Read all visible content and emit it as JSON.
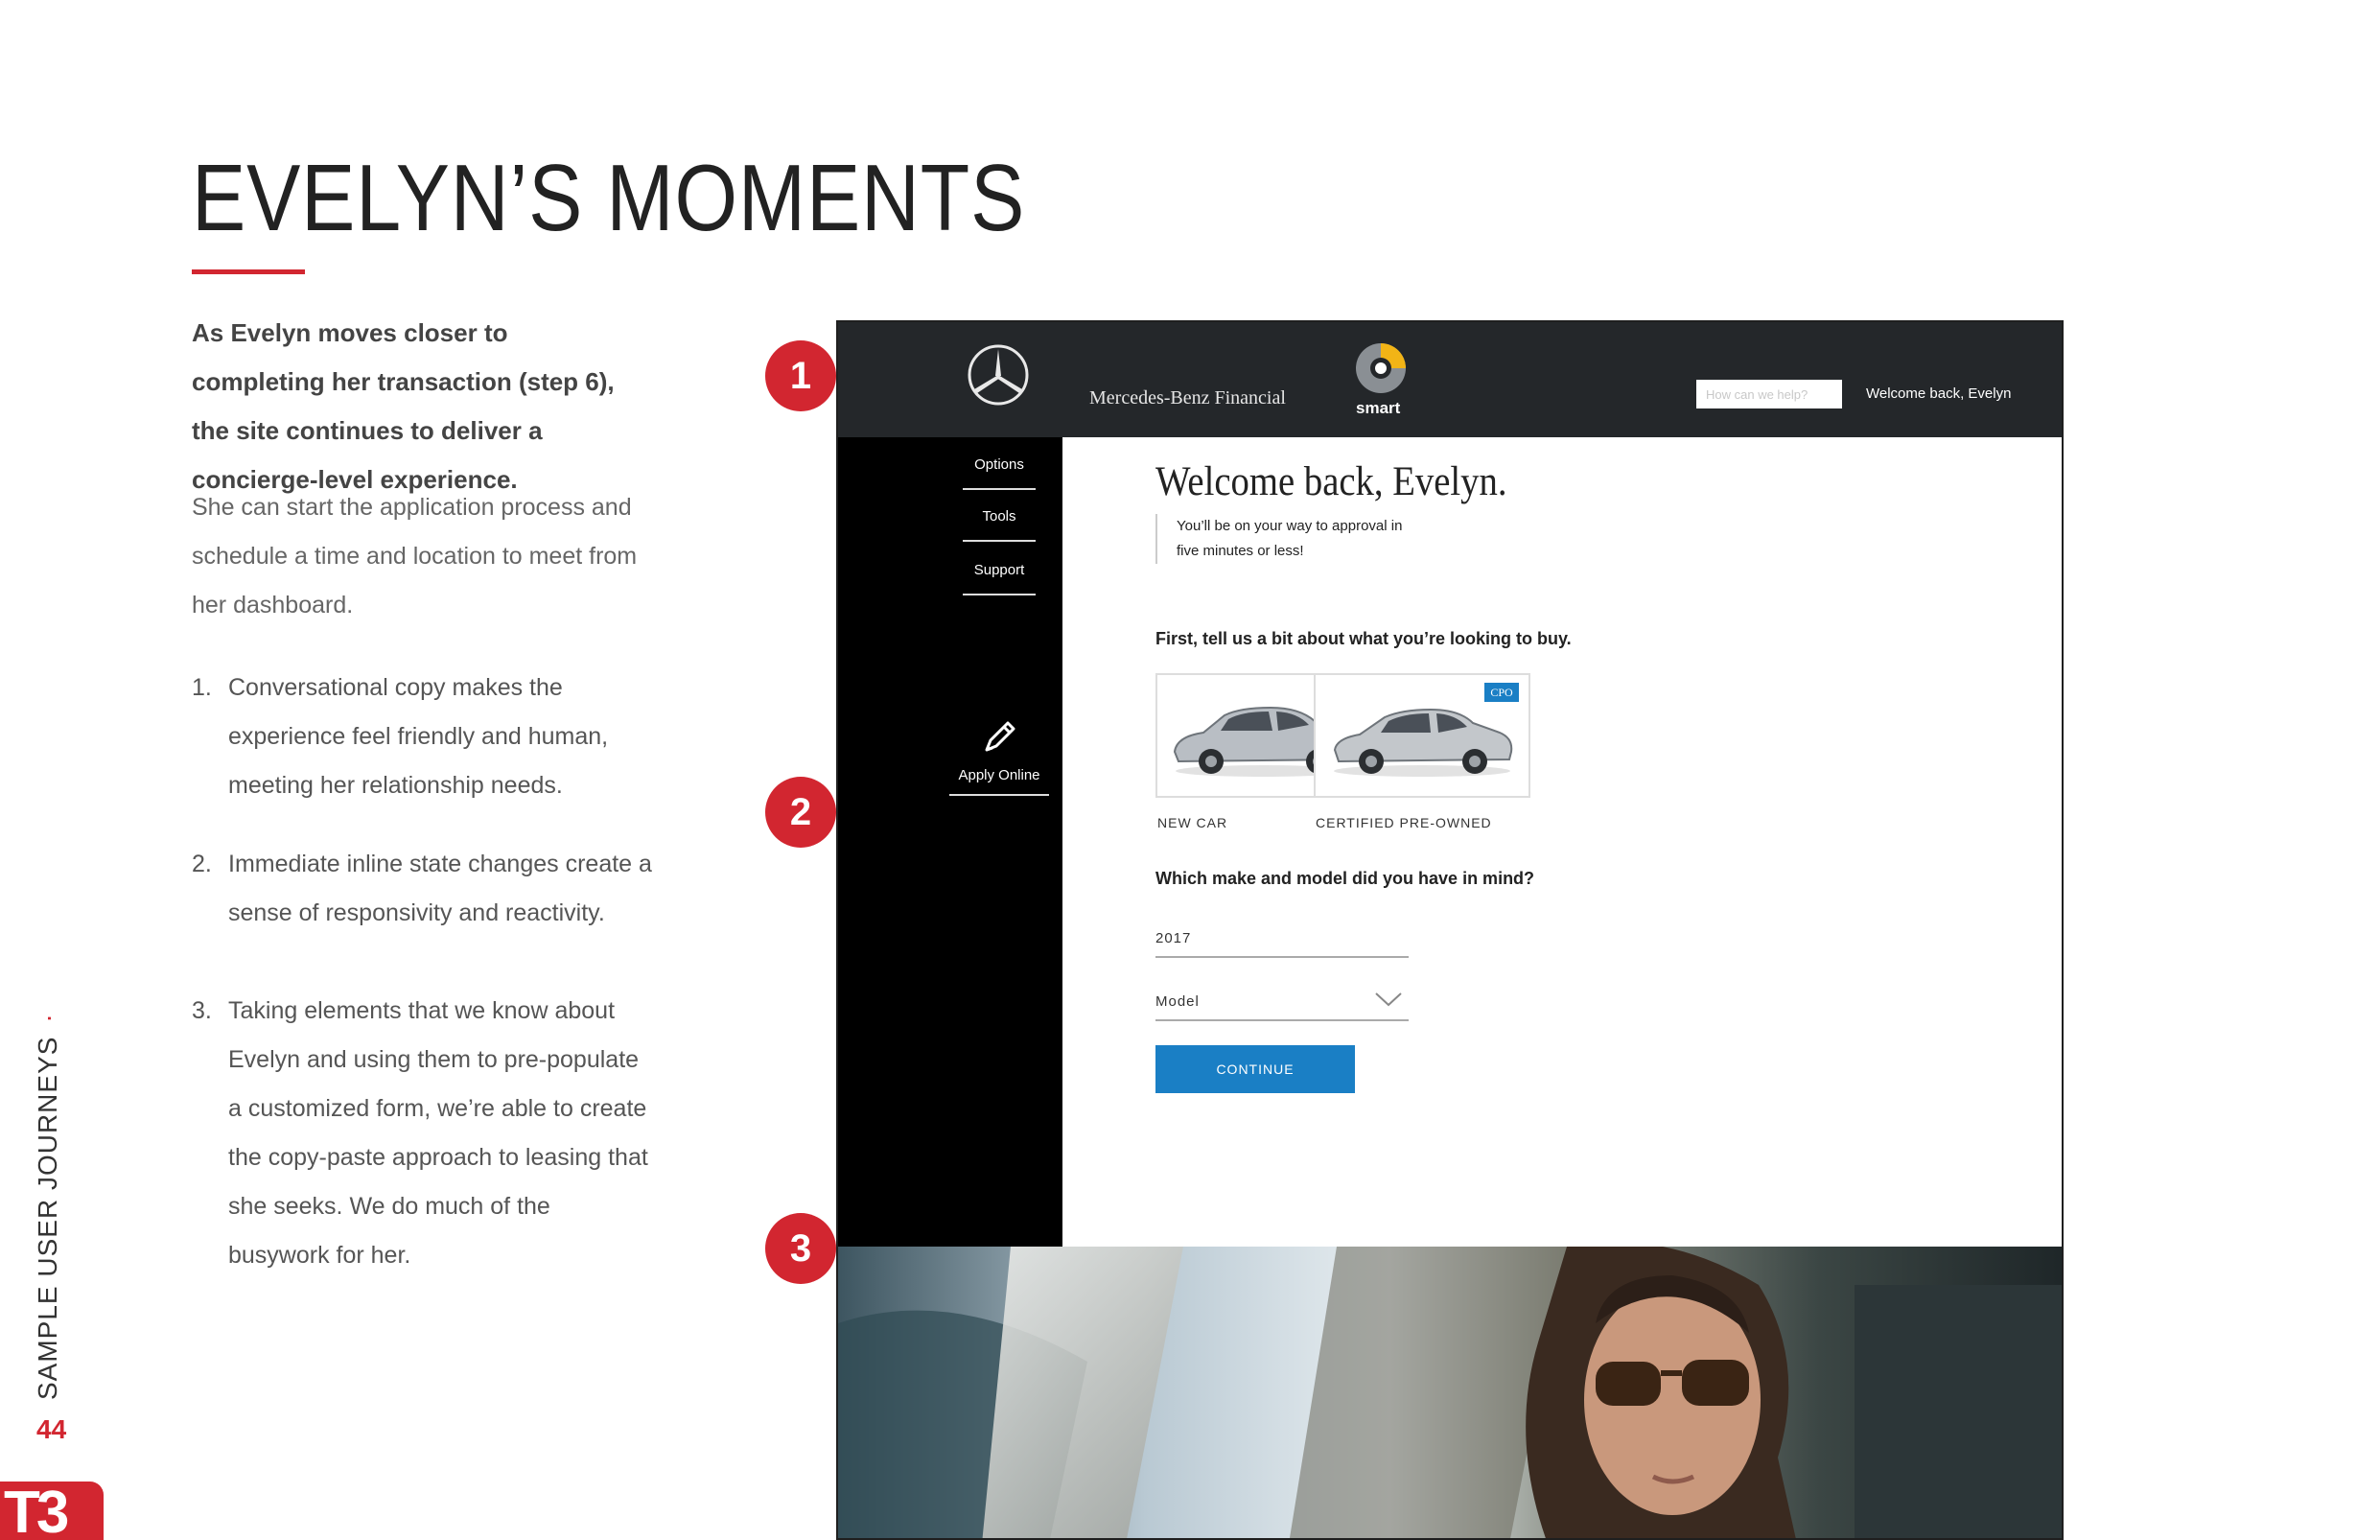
{
  "page": {
    "title": "EVELYN’S MOMENTS",
    "lead": "As Evelyn moves closer to completing her transaction (step 6), the site continues to deliver a concierge-level experience.",
    "paragraph": "She can start the application process and schedule a time and location to meet from her dashboard.",
    "list": [
      {
        "num": "1.",
        "text": "Conversational copy makes the experience feel friendly and human, meeting her relationship needs."
      },
      {
        "num": "2.",
        "text": "Immediate inline state changes create a sense of responsivity and reactivity."
      },
      {
        "num": "3.",
        "text": "Taking elements that we know about Evelyn and using them to pre-populate a customized form, we’re able to create the copy-paste approach to leasing that she seeks. We do much of the busywork for her."
      }
    ],
    "side_label": "SAMPLE USER JOURNEYS",
    "side_dot": "·",
    "page_number": "44",
    "logo": "T3",
    "callouts": [
      "1",
      "2",
      "3"
    ],
    "colors": {
      "accent": "#d22630",
      "header": "#24272a",
      "button": "#1a7fc5"
    }
  },
  "site": {
    "brand": "Mercedes-Benz Financial",
    "smart_word": "smart",
    "search_placeholder": "How can we help?",
    "welcome_link": "Welcome back, Evelyn",
    "nav": [
      "Options",
      "Tools",
      "Support"
    ],
    "apply_online": "Apply Online",
    "heading": "Welcome back, Evelyn.",
    "subline": "You’ll be on your way to approval in five minutes or less!",
    "question1": "First, tell us a bit about what you’re looking to buy.",
    "cars": [
      {
        "label": "NEW CAR",
        "color": "#b9bec4"
      },
      {
        "label": "CERTIFIED PRE-OWNED",
        "color": "#c3c7cb",
        "badge": "CPO"
      }
    ],
    "question2": "Which make and model did you have in mind?",
    "year_value": "2017",
    "model_value": "Model",
    "continue_label": "CONTINUE"
  }
}
